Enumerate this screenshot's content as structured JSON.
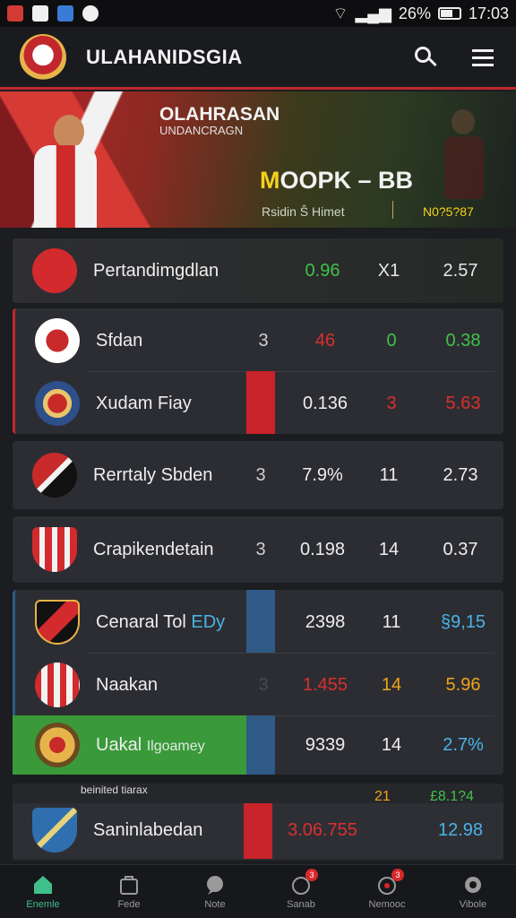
{
  "status_bar": {
    "battery": "26%",
    "time": "17:03"
  },
  "header": {
    "title": "ULAHANIDSGIA"
  },
  "banner": {
    "title": "OLAHRASAN",
    "subtitle": "UNDANCRAGN",
    "score_accent": "M",
    "score_rest": "OOPK – BB",
    "info": "Rsidin Ŝ Himet",
    "code": "N0?5?87"
  },
  "rows": [
    {
      "team": "Pertandimgdlan",
      "c1": "",
      "c2": "0.96",
      "c3": "X1",
      "c4": "2.57"
    },
    {
      "team": "Sfdan",
      "c1": "3",
      "c2": "46",
      "c3": "0",
      "c4": "0.38"
    },
    {
      "team": "Xudam Fiay",
      "c1": "",
      "c2": "0.136",
      "c3": "3",
      "c4": "5.63"
    },
    {
      "team": "Rerrtaly Sbden",
      "c1": "3",
      "c2": "7.9%",
      "c3": "11",
      "c4": "2.73"
    },
    {
      "team": "Crapikendetain",
      "c1": "3",
      "c2": "0.198",
      "c3": "14",
      "c4": "0.37"
    },
    {
      "team_a": "Cenaral Tol ",
      "team_b": "EDy",
      "c1": "",
      "c2": "2398",
      "c3": "11",
      "c4": "§9,15"
    },
    {
      "team": "Naakan",
      "c1": "3",
      "c2": "1.455",
      "c3": "14",
      "c4": "5.96"
    },
    {
      "team_a": "Uakal ",
      "team_b": "Ilgoamey",
      "c1": "",
      "c2": "9339",
      "c3": "14",
      "c4": "2.7%"
    },
    {
      "team": "Saninlabedan",
      "sub": "beinited tiarax",
      "c2": "3.06.755",
      "c3": "21",
      "c4": "12.98",
      "c4_top": "£8.1?4"
    }
  ],
  "nav": [
    {
      "label": "Enemle",
      "icon": "home-icon"
    },
    {
      "label": "Fede",
      "icon": "bag-icon"
    },
    {
      "label": "Note",
      "icon": "chat-icon"
    },
    {
      "label": "Sanab",
      "icon": "bell-icon",
      "badge": "3"
    },
    {
      "label": "Nemooc",
      "icon": "alert-icon",
      "badge": "3"
    },
    {
      "label": "Vibole",
      "icon": "gear-icon"
    }
  ],
  "colors": {
    "accent_red": "#c2272d",
    "green": "#3fc24a",
    "yellow": "#f4d11a",
    "blue": "#4ab3e8"
  }
}
